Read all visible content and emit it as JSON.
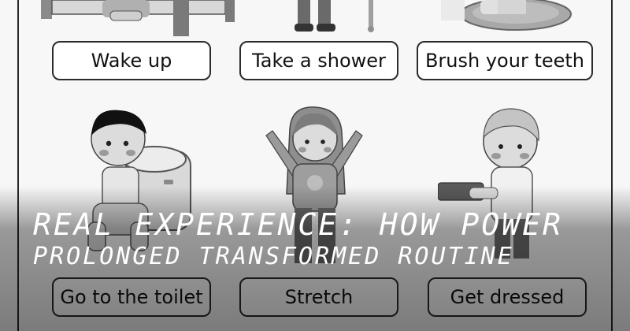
{
  "worksheet": {
    "top_row": {
      "wake": "Wake up",
      "shower": "Take a shower",
      "brush": "Brush your teeth"
    },
    "bottom_row": {
      "toilet": "Go to the toilet",
      "stretch": "Stretch",
      "dress": "Get dressed"
    }
  },
  "overlay": {
    "line1": "REAL EXPERIENCE: HOW POWER",
    "line2": "PROLONGED TRANSFORMED ROUTINE"
  }
}
